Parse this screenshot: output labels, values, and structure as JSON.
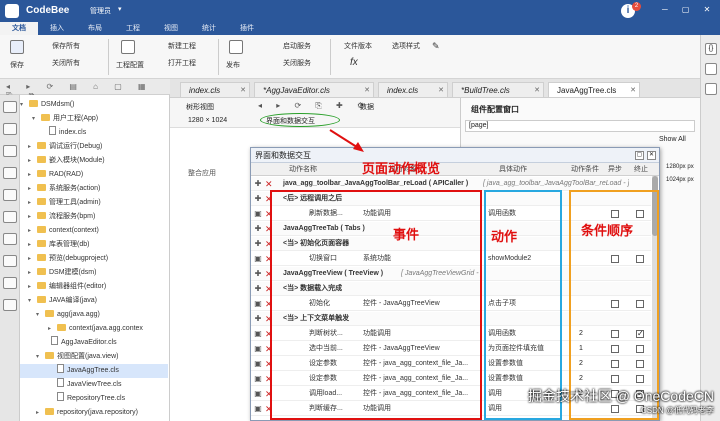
{
  "app": {
    "title": "CodeBee",
    "user": "管理员",
    "notify_count": "2"
  },
  "menu": [
    "文档",
    "插入",
    "布局",
    "工程",
    "视图",
    "统计",
    "插件"
  ],
  "ribbon": {
    "save": "保存",
    "save_all": "保存所有",
    "close_all": "关闭所有",
    "project_config": "工程配置",
    "new_project": "新建工程",
    "open_project": "打开工程",
    "publish": "发布",
    "start_service": "启动服务",
    "stop_service": "关闭服务",
    "file_version": "文件版本",
    "option_style": "选项样式"
  },
  "tabs": [
    {
      "label": "index.cls",
      "active": false
    },
    {
      "label": "*AggJavaEditor.cls",
      "active": false
    },
    {
      "label": "index.cls",
      "active": false
    },
    {
      "label": "*BuildTree.cls",
      "active": false
    },
    {
      "label": "JavaAggTree.cls",
      "active": true
    }
  ],
  "tree": [
    "DSMdsm()",
    "用户工程(App)",
    "index.cls",
    "调试运行(Debug)",
    "嵌入模块(Module)",
    "RAD(RAD)",
    "系统服务(action)",
    "管理工具(admin)",
    "流程服务(bpm)",
    "context(context)",
    "库表管理(db)",
    "预览(debugproject)",
    "DSM建模(dsm)",
    "编辑器组件(editor)",
    "JAVA编译(java)",
    "agg(java.agg)",
    "context(java.agg.contex",
    "AggJavaEditor.cls",
    "视图配置(java.view)",
    "JavaAggTree.cls",
    "JavaViewTree.cls",
    "RepositoryTree.cls",
    "repository(java.repository)"
  ],
  "editor": {
    "tool_relation": "树形视图",
    "size_label": "1280 × 1024",
    "page_interaction_button": "界面和数据交互",
    "data_dropdown": "数据",
    "subtitle": "整合应用"
  },
  "right_panel": {
    "title": "组件配置窗口",
    "field": "[page]",
    "show_all": "Show All",
    "value_1": "1280px px",
    "value_2": "1024px px"
  },
  "dialog": {
    "title": "界面和数据交互",
    "columns": [
      "动作名称",
      "执行对象",
      "具体动作",
      "动作条件",
      "异步",
      "终止"
    ],
    "rows": [
      {
        "label": "java_agg_toolbar_JavaAggToolBar_reLoad ( APICaller )",
        "target": " [ java_agg_toolbar_JavaAggToolBar_reLoad - ] ",
        "bold": true,
        "action": "",
        "cond": "",
        "async": false,
        "stop": false,
        "checks": false
      },
      {
        "label": "<后> 远程调用之后",
        "target": "",
        "bold": true,
        "action": "",
        "cond": "",
        "async": false,
        "stop": false,
        "checks": false
      },
      {
        "label": "刷新数据...",
        "target": "功能调用",
        "bold": false,
        "action": "调用函数",
        "cond": "",
        "async": false,
        "stop": false,
        "checks": true
      },
      {
        "label": "JavaAggTreeTab ( Tabs )",
        "target": "",
        "bold": true,
        "action": "",
        "cond": "",
        "async": false,
        "stop": false,
        "checks": false
      },
      {
        "label": "<当> 初始化页面容器",
        "target": "",
        "bold": true,
        "action": "",
        "cond": "",
        "async": false,
        "stop": false,
        "checks": false
      },
      {
        "label": "切换窗口",
        "target": "系统功能",
        "bold": false,
        "action": "showModule2",
        "cond": "",
        "async": false,
        "stop": false,
        "checks": true
      },
      {
        "label": "JavaAggTreeView ( TreeView )",
        "target": " [ JavaAggTreeViewGrid - ] ",
        "bold": true,
        "action": "",
        "cond": "",
        "async": false,
        "stop": false,
        "checks": false
      },
      {
        "label": "<当> 数据载入完成",
        "target": "",
        "bold": true,
        "action": "",
        "cond": "",
        "async": false,
        "stop": false,
        "checks": false
      },
      {
        "label": "初始化",
        "target": "控件 - JavaAggTreeView",
        "bold": false,
        "action": "点击子项",
        "cond": "",
        "async": false,
        "stop": false,
        "checks": true
      },
      {
        "label": "<当> 上下文菜单触发",
        "target": "",
        "bold": true,
        "action": "",
        "cond": "",
        "async": false,
        "stop": false,
        "checks": false
      },
      {
        "label": "判断树状...",
        "target": "功能调用",
        "bold": false,
        "action": "调用函数",
        "cond": "2",
        "async": false,
        "stop": true,
        "checks": true
      },
      {
        "label": "选中当前...",
        "target": "控件 - JavaAggTreeView",
        "bold": false,
        "action": "为页面控件填充值",
        "cond": "1",
        "async": false,
        "stop": false,
        "checks": true
      },
      {
        "label": "设定参数",
        "target": "控件 - java_agg_context_file_Ja...",
        "bold": false,
        "action": "设置参数值",
        "cond": "2",
        "async": false,
        "stop": false,
        "checks": true
      },
      {
        "label": "设定参数",
        "target": "控件 - java_agg_context_file_Ja...",
        "bold": false,
        "action": "设置参数值",
        "cond": "2",
        "async": false,
        "stop": false,
        "checks": true
      },
      {
        "label": "调用load...",
        "target": "控件 - java_agg_context_file_Ja...",
        "bold": false,
        "action": "调用",
        "cond": "2",
        "async": false,
        "stop": true,
        "checks": true
      },
      {
        "label": "判断缓存...",
        "target": "功能调用",
        "bold": false,
        "action": "调用",
        "cond": "",
        "async": false,
        "stop": false,
        "checks": true
      }
    ]
  },
  "annotations": {
    "overview": "页面动作概览",
    "events": "事件",
    "actions": "动作",
    "conditions": "条件顺序",
    "color_red": "#e01010",
    "color_blue": "#28a8e0",
    "color_orange": "#f0a020"
  },
  "watermark": {
    "main": "掘金技术社区 @ OneCodeCN",
    "sub": "CSDN @低代码老李"
  }
}
